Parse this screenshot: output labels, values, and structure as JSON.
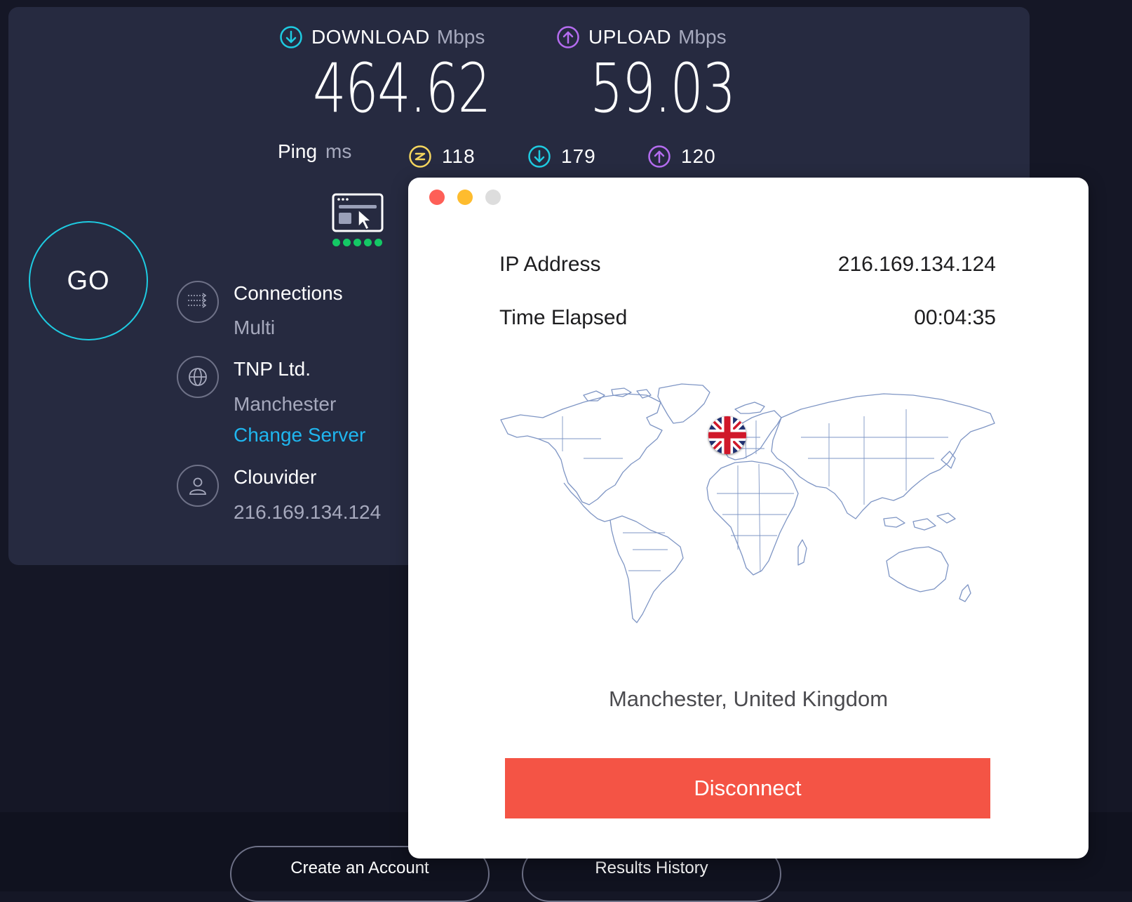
{
  "speedtest": {
    "download": {
      "label": "DOWNLOAD",
      "unit": "Mbps",
      "value": "464.62"
    },
    "upload": {
      "label": "UPLOAD",
      "unit": "Mbps",
      "value": "59.03"
    },
    "ping": {
      "label": "Ping",
      "unit": "ms",
      "idle": "118",
      "download": "179",
      "upload": "120"
    },
    "go_label": "GO",
    "connections": {
      "title": "Connections",
      "value": "Multi"
    },
    "server": {
      "title": "TNP Ltd.",
      "city": "Manchester",
      "change_label": "Change Server"
    },
    "provider": {
      "title": "Clouvider",
      "ip": "216.169.134.124"
    },
    "signal_dots": 5,
    "bottom": {
      "create_account": "Create an Account",
      "results_history": "Results History"
    },
    "colors": {
      "download_icon": "#1ecbe1",
      "upload_icon": "#b56cf0",
      "ping_icon": "#f5d65e",
      "go_ring": "#1ecbe1",
      "link": "#1fb6ef",
      "dots": "#14c865"
    }
  },
  "vpn": {
    "rows": [
      {
        "label": "IP Address",
        "value": "216.169.134.124"
      },
      {
        "label": "Time Elapsed",
        "value": "00:04:35"
      }
    ],
    "location": "Manchester, United Kingdom",
    "disconnect_label": "Disconnect",
    "flag_icon": "uk-flag-icon",
    "colors": {
      "disconnect": "#f45445",
      "close": "#fe5f57",
      "minimize": "#febc2e",
      "zoom": "#dddddd"
    }
  }
}
